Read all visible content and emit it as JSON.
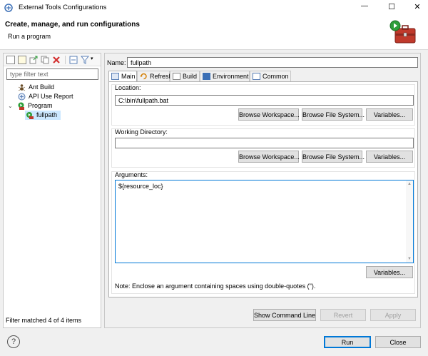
{
  "window": {
    "title": "External Tools Configurations",
    "controls": {
      "minimize": "—",
      "maximize": "☐",
      "close": "✕"
    }
  },
  "header": {
    "title": "Create, manage, and run configurations",
    "subtitle": "Run a program"
  },
  "left_panel": {
    "filter_placeholder": "type filter text",
    "tree": [
      {
        "label": "Ant Build",
        "icon": "ant-build-icon",
        "level": 1
      },
      {
        "label": "API Use Report",
        "icon": "api-use-report-icon",
        "level": 1
      },
      {
        "label": "Program",
        "icon": "program-icon",
        "level": 1,
        "expanded": true
      },
      {
        "label": "fullpath",
        "icon": "program-config-icon",
        "level": 2,
        "selected": true
      }
    ],
    "status": "Filter matched 4 of 4 items"
  },
  "config": {
    "name_label": "Name:",
    "name_value": "fullpath",
    "tabs": [
      {
        "label": "Main",
        "icon": "main-tab-icon",
        "active": true
      },
      {
        "label": "Refresh",
        "icon": "refresh-tab-icon"
      },
      {
        "label": "Build",
        "icon": "build-tab-icon"
      },
      {
        "label": "Environment",
        "icon": "environment-tab-icon"
      },
      {
        "label": "Common",
        "icon": "common-tab-icon"
      }
    ],
    "location": {
      "label": "Location:",
      "value": "C:\\bin\\fullpath.bat",
      "buttons": [
        "Browse Workspace...",
        "Browse File System...",
        "Variables..."
      ]
    },
    "working_directory": {
      "label": "Working Directory:",
      "value": "",
      "buttons": [
        "Browse Workspace...",
        "Browse File System...",
        "Variables..."
      ]
    },
    "arguments": {
      "label": "Arguments:",
      "value": "${resource_loc}",
      "variables_button": "Variables...",
      "note": "Note: Enclose an argument containing spaces using double-quotes (\")."
    },
    "bottom_buttons": {
      "show_command_line": "Show Command Line",
      "revert": "Revert",
      "apply": "Apply"
    }
  },
  "footer": {
    "help": "?",
    "run": "Run",
    "close": "Close"
  },
  "colors": {
    "accent": "#0078d7",
    "selection": "#cce8ff",
    "error_red": "#d32f2f",
    "toolbox_red": "#c0392b"
  }
}
